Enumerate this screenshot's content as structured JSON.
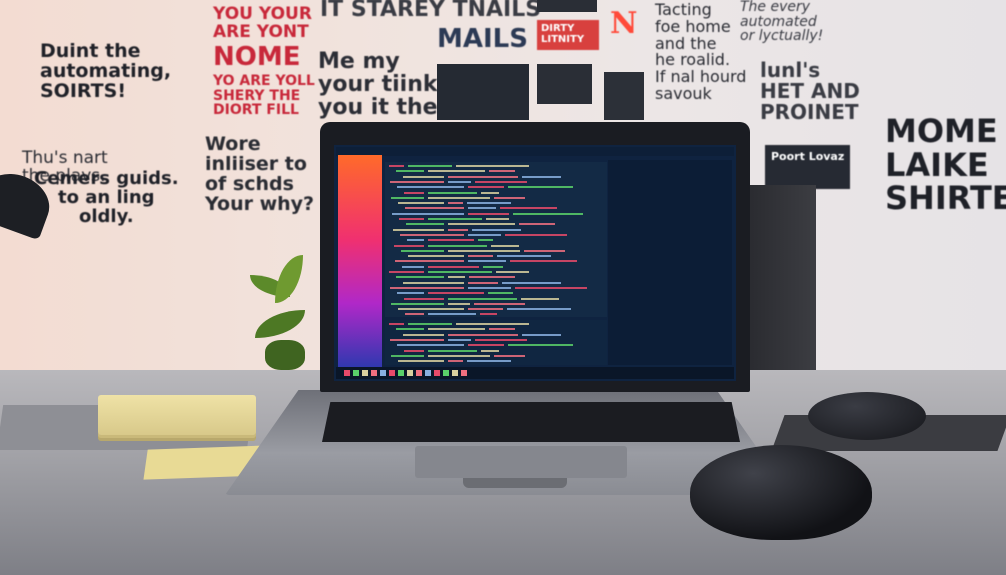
{
  "wall": {
    "texts": [
      "YOU YOUR\nARE YONT",
      "NOME",
      "YO ARE YOLL\nSHERY THE\nDIORT FILL",
      "IT STAREY TNAILS",
      "MAILS",
      "Me my\nyour tiink\nyou it the",
      "Duint the\nautomating,\nSOIRTS!",
      "Thu's nart\nthe plavs.",
      "Cemers guids.\nto an ling\noldly.",
      "Wore\ninliiser to\nof schds\nYour why?",
      "Tacting\nfoe home\nand the\nhe roalid.\nIf nal hourd\nsavouk",
      "The every\nautomated\nor lyctually!",
      "lunl's\nHET AND\nPROINET",
      "MOME\nLAIKE\nSHIRTE",
      "N",
      "DIRTY\nLITNITY",
      "Poort Lovaz"
    ]
  },
  "colors": {
    "red": "#c8283a",
    "dark": "#2a2c33",
    "accent": "#ff4a3a"
  },
  "icons": [
    "laptop",
    "mouse",
    "sticky-notes",
    "plant",
    "lamp",
    "speaker"
  ]
}
